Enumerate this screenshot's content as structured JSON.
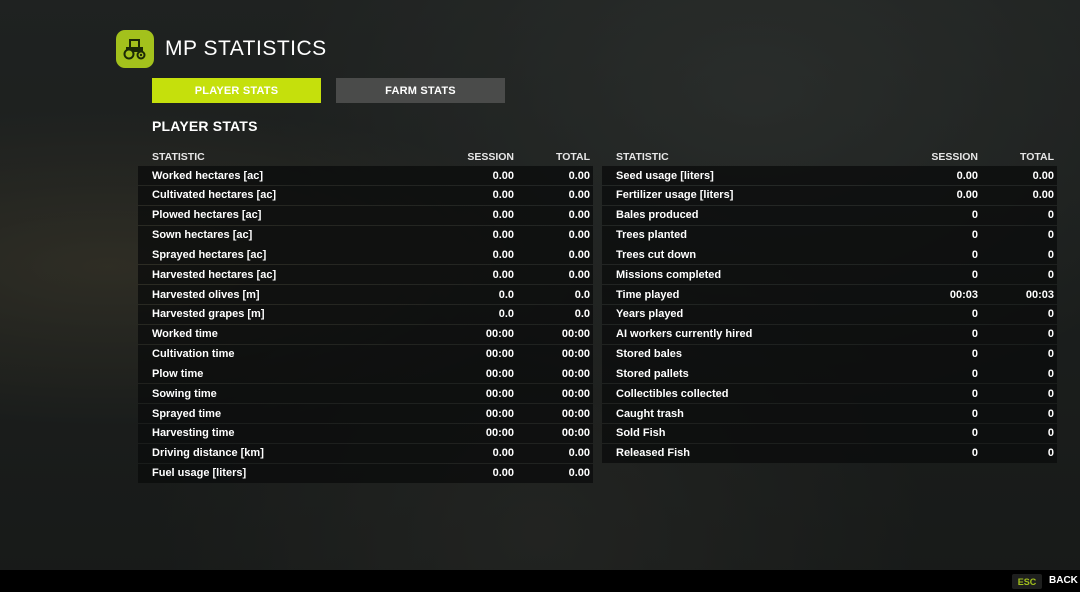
{
  "header": {
    "title": "MP STATISTICS",
    "logo_icon": "tractor-icon"
  },
  "tabs": [
    {
      "label": "PLAYER STATS",
      "active": true
    },
    {
      "label": "FARM STATS",
      "active": false
    }
  ],
  "section_title": "PLAYER STATS",
  "columns": {
    "statistic": "STATISTIC",
    "session": "SESSION",
    "total": "TOTAL"
  },
  "left_rows": [
    {
      "name": "Worked hectares [ac]",
      "session": "0.00",
      "total": "0.00"
    },
    {
      "name": "Cultivated hectares [ac]",
      "session": "0.00",
      "total": "0.00"
    },
    {
      "name": "Plowed hectares [ac]",
      "session": "0.00",
      "total": "0.00"
    },
    {
      "name": "Sown hectares [ac]",
      "session": "0.00",
      "total": "0.00"
    },
    {
      "name": "Sprayed hectares [ac]",
      "session": "0.00",
      "total": "0.00"
    },
    {
      "name": "Harvested hectares [ac]",
      "session": "0.00",
      "total": "0.00"
    },
    {
      "name": "Harvested olives [m]",
      "session": "0.0",
      "total": "0.0"
    },
    {
      "name": "Harvested grapes [m]",
      "session": "0.0",
      "total": "0.0"
    },
    {
      "name": "Worked time",
      "session": "00:00",
      "total": "00:00"
    },
    {
      "name": "Cultivation time",
      "session": "00:00",
      "total": "00:00"
    },
    {
      "name": "Plow time",
      "session": "00:00",
      "total": "00:00"
    },
    {
      "name": "Sowing time",
      "session": "00:00",
      "total": "00:00"
    },
    {
      "name": "Sprayed time",
      "session": "00:00",
      "total": "00:00"
    },
    {
      "name": "Harvesting time",
      "session": "00:00",
      "total": "00:00"
    },
    {
      "name": "Driving distance [km]",
      "session": "0.00",
      "total": "0.00"
    },
    {
      "name": "Fuel usage [liters]",
      "session": "0.00",
      "total": "0.00"
    }
  ],
  "right_rows": [
    {
      "name": "Seed usage [liters]",
      "session": "0.00",
      "total": "0.00"
    },
    {
      "name": "Fertilizer usage [liters]",
      "session": "0.00",
      "total": "0.00"
    },
    {
      "name": "Bales produced",
      "session": "0",
      "total": "0"
    },
    {
      "name": "Trees planted",
      "session": "0",
      "total": "0"
    },
    {
      "name": "Trees cut down",
      "session": "0",
      "total": "0"
    },
    {
      "name": "Missions completed",
      "session": "0",
      "total": "0"
    },
    {
      "name": "Time played",
      "session": "00:03",
      "total": "00:03"
    },
    {
      "name": "Years played",
      "session": "0",
      "total": "0"
    },
    {
      "name": "AI workers currently hired",
      "session": "0",
      "total": "0"
    },
    {
      "name": "Stored bales",
      "session": "0",
      "total": "0"
    },
    {
      "name": "Stored pallets",
      "session": "0",
      "total": "0"
    },
    {
      "name": "Collectibles collected",
      "session": "0",
      "total": "0"
    },
    {
      "name": "Caught trash",
      "session": "0",
      "total": "0"
    },
    {
      "name": "Sold Fish",
      "session": "0",
      "total": "0"
    },
    {
      "name": "Released Fish",
      "session": "0",
      "total": "0"
    }
  ],
  "footer": {
    "key_label": "ESC",
    "action_label": "BACK"
  },
  "colors": {
    "accent": "#c5e00c",
    "logo": "#a3c11c",
    "tab_inactive": "#4a4b4a",
    "row_bg": "#0a0b0b"
  }
}
